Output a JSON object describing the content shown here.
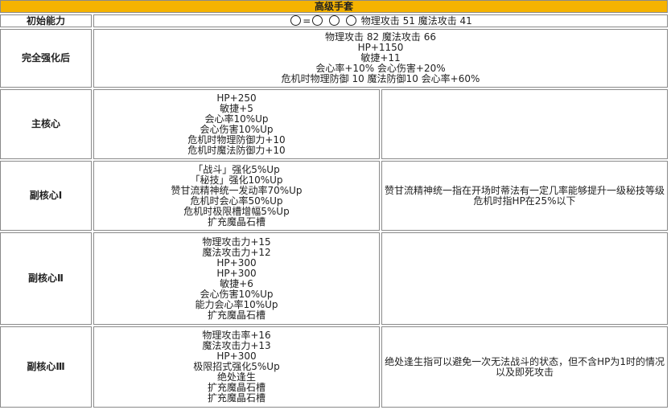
{
  "title": "高级手套",
  "initial": {
    "label": "初始能力",
    "sep": "=",
    "text": "物理攻击 51 魔法攻击 41"
  },
  "full": {
    "label": "完全强化后",
    "lines": [
      "物理攻击 82 魔法攻击 66",
      "HP+1150",
      "敏捷+11",
      "会心率+10% 会心伤害+20%",
      "危机时物理防御 10 魔法防御10 会心率+60%"
    ]
  },
  "main": {
    "label": "主核心",
    "lines": [
      "HP+250",
      "敏捷+5",
      "会心率10%Up",
      "会心伤害10%Up",
      "危机时物理防御力+10",
      "危机时魔法防御力+10"
    ],
    "note": []
  },
  "sub1": {
    "label": "副核心Ⅰ",
    "lines": [
      "「战斗」强化5%Up",
      "「秘技」强化10%Up",
      "赞甘流精神统一发动率70%Up",
      "危机时会心率50%Up",
      "危机时极限槽增幅5%Up",
      "扩充魔晶石槽"
    ],
    "note": [
      "赞甘流精神统一指在开场时蒂法有一定几率能够提升一级秘技等级",
      "危机时指HP在25%以下"
    ]
  },
  "sub2": {
    "label": "副核心Ⅱ",
    "lines": [
      "物理攻击力+15",
      "魔法攻击力+12",
      "HP+300",
      "HP+300",
      "敏捷+6",
      "会心伤害10%Up",
      "能力会心率10%Up",
      "扩充魔晶石槽"
    ],
    "note": []
  },
  "sub3": {
    "label": "副核心Ⅲ",
    "lines": [
      "物理攻击率+16",
      "魔法攻击力+13",
      "HP+300",
      "极限招式强化5%Up",
      "绝处逢生",
      "扩充魔晶石槽",
      "扩充魔晶石槽"
    ],
    "note": [
      "绝处逢生指可以避免一次无法战斗的状态，但不含HP为1时的情况以及即死攻击"
    ]
  }
}
